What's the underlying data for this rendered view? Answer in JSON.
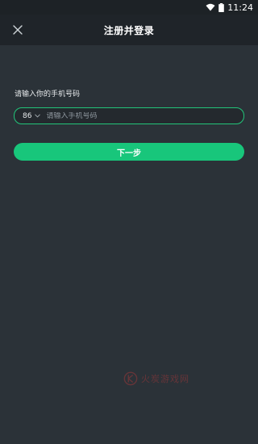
{
  "status_bar": {
    "time": "11:24",
    "icons": [
      "wifi-icon",
      "battery-icon"
    ]
  },
  "header": {
    "title": "注册并登录",
    "close_icon": "close-icon"
  },
  "form": {
    "prompt": "请输入你的手机号码",
    "country_code": "86",
    "country_code_icon": "chevron-down-icon",
    "phone_placeholder": "请输入手机号码",
    "phone_value": ""
  },
  "actions": {
    "next_label": "下一步"
  },
  "watermark": {
    "text": "火炭游戏网"
  },
  "colors": {
    "background": "#2b3238",
    "header": "#1f2429",
    "accent": "#18c67b"
  }
}
